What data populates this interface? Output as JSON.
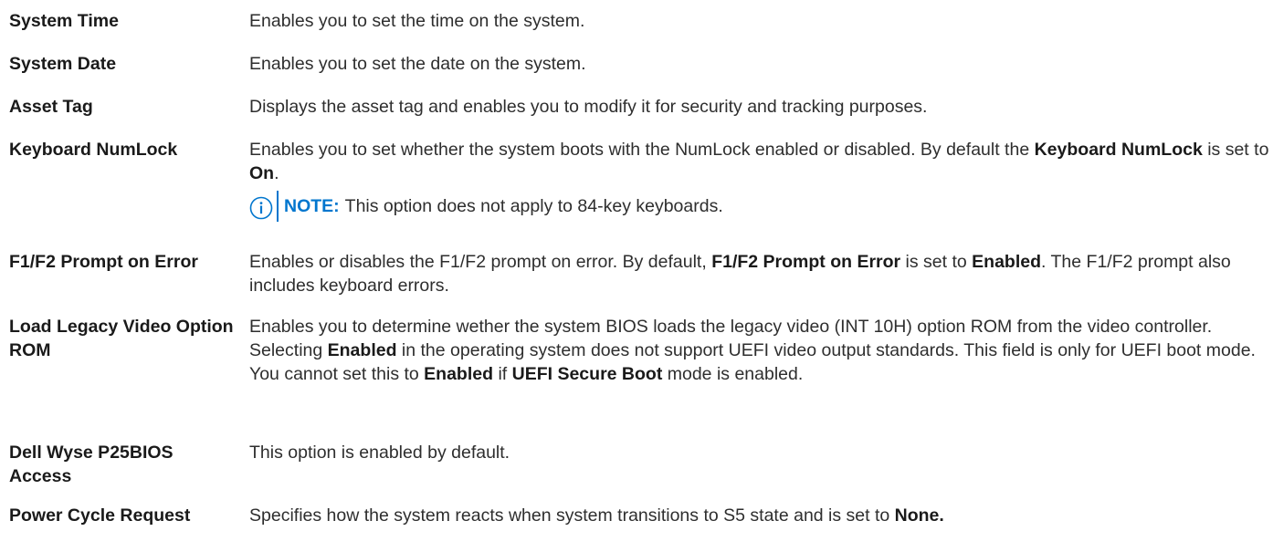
{
  "rows": [
    {
      "term": "System Time",
      "desc": "Enables you to set the time on the system."
    },
    {
      "term": "System Date",
      "desc": "Enables you to set the date on the system."
    },
    {
      "term": "Asset Tag",
      "desc": "Displays the asset tag and enables you to modify it for security and tracking purposes."
    },
    {
      "term": "Keyboard NumLock",
      "desc_parts": [
        "Enables you to set whether the system boots with the NumLock enabled or disabled. By default the ",
        "Keyboard NumLock",
        " is set to ",
        "On",
        "."
      ],
      "note_label": "NOTE:",
      "note_text": "This option does not apply to 84-key keyboards."
    },
    {
      "term": "F1/F2 Prompt on Error",
      "desc_parts": [
        "Enables or disables the F1/F2 prompt on error. By default, ",
        "F1/F2 Prompt on Error",
        " is set to ",
        "Enabled",
        ". The F1/F2 prompt also includes keyboard errors."
      ]
    },
    {
      "term": "Load Legacy Video Option ROM",
      "desc_parts": [
        "Enables you to determine wether the system BIOS loads the legacy video (INT 10H) option ROM from the video controller. Selecting ",
        "Enabled",
        " in the operating system does not support UEFI video output standards. This field is only for UEFI boot mode. You cannot set this to ",
        "Enabled",
        " if ",
        "UEFI Secure Boot",
        " mode is enabled."
      ]
    },
    {
      "term": "Dell Wyse P25BIOS Access",
      "desc": "This option is enabled by default."
    },
    {
      "term": "Power Cycle Request",
      "desc_parts": [
        "Specifies how the system reacts when system transitions to S5 state and is set to ",
        "None."
      ]
    }
  ],
  "colors": {
    "text": "#2e2e2e",
    "accent": "#0076ce"
  },
  "icons": {
    "note": "info-circle-icon"
  }
}
